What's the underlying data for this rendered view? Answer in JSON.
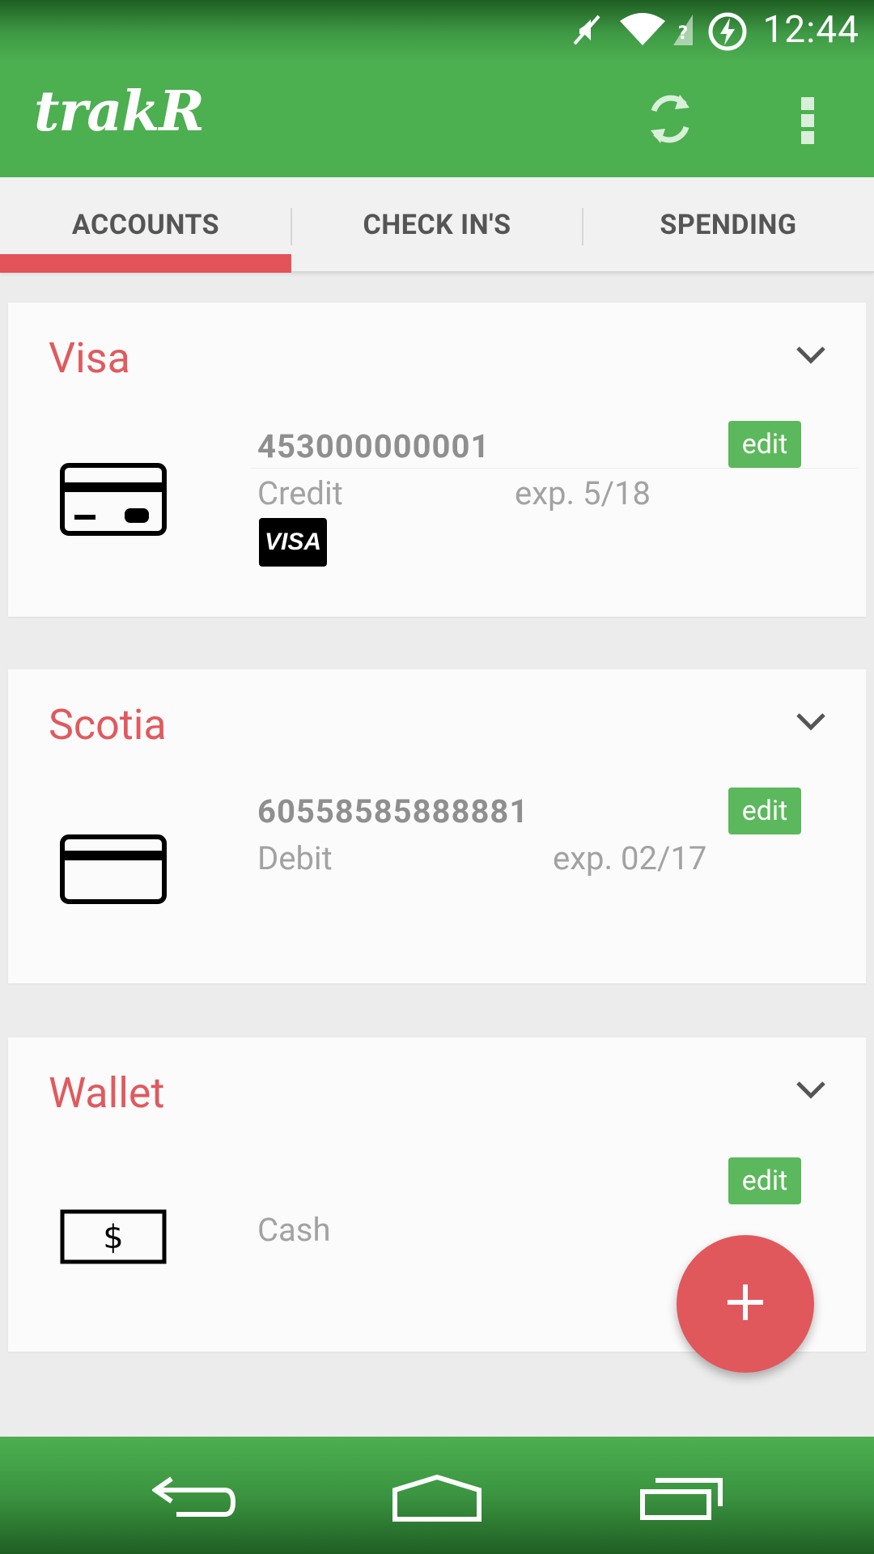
{
  "status_bar": {
    "time": "12:44",
    "icons": [
      "mute-icon",
      "wifi-icon",
      "no-sim-icon",
      "battery-charging-icon"
    ]
  },
  "app_bar": {
    "title": "trakR",
    "actions": [
      "refresh-icon",
      "overflow-menu-icon"
    ]
  },
  "tabs": [
    {
      "label": "ACCOUNTS",
      "selected": true
    },
    {
      "label": "CHECK IN'S",
      "selected": false
    },
    {
      "label": "SPENDING",
      "selected": false
    }
  ],
  "accounts": [
    {
      "name": "Visa",
      "icon": "credit-card-icon",
      "number": "453000000001",
      "type": "Credit",
      "expiry": "exp. 5/18",
      "brand": "VISA",
      "edit_label": "edit"
    },
    {
      "name": "Scotia",
      "icon": "debit-card-icon",
      "number": "60558585888881",
      "type": "Debit",
      "expiry": "exp. 02/17",
      "edit_label": "edit"
    },
    {
      "name": "Wallet",
      "icon": "cash-icon",
      "type": "Cash",
      "edit_label": "edit"
    }
  ],
  "fab": {
    "icon": "plus-icon"
  },
  "nav_bar": {
    "icons": [
      "back-icon",
      "home-icon",
      "recents-icon"
    ]
  },
  "colors": {
    "primary": "#4caf50",
    "accent": "#e0585c",
    "edit_button": "#5cb85c"
  }
}
